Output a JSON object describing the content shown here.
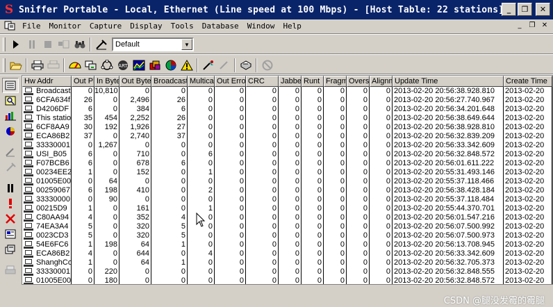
{
  "window": {
    "title": "Sniffer Portable - Local, Ethernet (Line speed at 100 Mbps) - [Host Table: 22 stations]",
    "logo": "S",
    "minimize": "_",
    "restore": "❐",
    "close": "✕"
  },
  "menu": [
    "File",
    "Monitor",
    "Capture",
    "Display",
    "Tools",
    "Database",
    "Window",
    "Help"
  ],
  "mdi": {
    "minimize": "_",
    "restore": "❐",
    "close": "✕"
  },
  "toolbar1": {
    "profile_value": "Default"
  },
  "columns": [
    "Hw Addr",
    "Out Pk",
    "In Byte",
    "Out Byte",
    "Broadcast",
    "Multicast",
    "Out Error",
    "CRC",
    "Jabber",
    "Runt",
    "Fragm",
    "Overs",
    "Alignm",
    "Update Time",
    "Create Time"
  ],
  "rows": [
    [
      "Broadcast",
      "0",
      "10,810",
      "0",
      "0",
      "0",
      "0",
      "0",
      "0",
      "0",
      "0",
      "0",
      "0",
      "2013-02-20 20:56:38.928.810",
      "2013-02-20"
    ],
    [
      "6CFA634f",
      "26",
      "0",
      "2,496",
      "26",
      "0",
      "0",
      "0",
      "0",
      "0",
      "0",
      "0",
      "0",
      "2013-02-20 20:56:27.740.967",
      "2013-02-20"
    ],
    [
      "D4206DF",
      "6",
      "0",
      "384",
      "6",
      "0",
      "0",
      "0",
      "0",
      "0",
      "0",
      "0",
      "0",
      "2013-02-20 20:56:34.201.648",
      "2013-02-20"
    ],
    [
      "This station",
      "35",
      "454",
      "2,252",
      "26",
      "0",
      "0",
      "0",
      "0",
      "0",
      "0",
      "0",
      "0",
      "2013-02-20 20:56:38.649.644",
      "2013-02-20"
    ],
    [
      "6CF8AA9",
      "30",
      "192",
      "1,926",
      "27",
      "0",
      "0",
      "0",
      "0",
      "0",
      "0",
      "0",
      "0",
      "2013-02-20 20:56:38.928.810",
      "2013-02-20"
    ],
    [
      "ECA86B2",
      "37",
      "0",
      "2,740",
      "37",
      "0",
      "0",
      "0",
      "0",
      "0",
      "0",
      "0",
      "0",
      "2013-02-20 20:56:32.839.209",
      "2013-02-20"
    ],
    [
      "33330001",
      "0",
      "1,267",
      "0",
      "0",
      "0",
      "0",
      "0",
      "0",
      "0",
      "0",
      "0",
      "0",
      "2013-02-20 20:56:33.342.609",
      "2013-02-20"
    ],
    [
      "USI_B05",
      "6",
      "0",
      "710",
      "0",
      "6",
      "0",
      "0",
      "0",
      "0",
      "0",
      "0",
      "0",
      "2013-02-20 20:56:32.848.572",
      "2013-02-20"
    ],
    [
      "F07BCB6",
      "6",
      "0",
      "678",
      "6",
      "0",
      "0",
      "0",
      "0",
      "0",
      "0",
      "0",
      "0",
      "2013-02-20 20:56:01.611.222",
      "2013-02-20"
    ],
    [
      "00234EE2",
      "1",
      "0",
      "152",
      "0",
      "1",
      "0",
      "0",
      "0",
      "0",
      "0",
      "0",
      "0",
      "2013-02-20 20:55:31.493.146",
      "2013-02-20"
    ],
    [
      "01005E00",
      "0",
      "64",
      "0",
      "0",
      "0",
      "0",
      "0",
      "0",
      "0",
      "0",
      "0",
      "0",
      "2013-02-20 20:55:37.118.466",
      "2013-02-20"
    ],
    [
      "00259067",
      "6",
      "198",
      "410",
      "0",
      "2",
      "0",
      "0",
      "0",
      "0",
      "0",
      "0",
      "0",
      "2013-02-20 20:56:38.428.184",
      "2013-02-20"
    ],
    [
      "33330000",
      "0",
      "90",
      "0",
      "0",
      "0",
      "0",
      "0",
      "0",
      "0",
      "0",
      "0",
      "0",
      "2013-02-20 20:55:37.118.484",
      "2013-02-20"
    ],
    [
      "00215D9",
      "1",
      "0",
      "161",
      "0",
      "1",
      "0",
      "0",
      "0",
      "0",
      "0",
      "0",
      "0",
      "2013-02-20 20:55:44.370.701",
      "2013-02-20"
    ],
    [
      "C80AA94",
      "4",
      "0",
      "352",
      "4",
      "0",
      "0",
      "0",
      "0",
      "0",
      "0",
      "0",
      "0",
      "2013-02-20 20:56:01.547.216",
      "2013-02-20"
    ],
    [
      "74EA3A4",
      "5",
      "0",
      "320",
      "5",
      "0",
      "0",
      "0",
      "0",
      "0",
      "0",
      "0",
      "0",
      "2013-02-20 20:56:07.500.992",
      "2013-02-20"
    ],
    [
      "0023CD3",
      "5",
      "0",
      "320",
      "5",
      "0",
      "0",
      "0",
      "0",
      "0",
      "0",
      "0",
      "0",
      "2013-02-20 20:56:07.500.973",
      "2013-02-20"
    ],
    [
      "54E6FC6",
      "1",
      "198",
      "64",
      "1",
      "0",
      "0",
      "0",
      "0",
      "0",
      "0",
      "0",
      "0",
      "2013-02-20 20:56:13.708.945",
      "2013-02-20"
    ],
    [
      "ECA86B2",
      "4",
      "0",
      "644",
      "0",
      "4",
      "0",
      "0",
      "0",
      "0",
      "0",
      "0",
      "0",
      "2013-02-20 20:56:33.342.609",
      "2013-02-20"
    ],
    [
      "ShanghCo",
      "1",
      "0",
      "64",
      "1",
      "0",
      "0",
      "0",
      "0",
      "0",
      "0",
      "0",
      "0",
      "2013-02-20 20:56:32.705.373",
      "2013-02-20"
    ],
    [
      "33330001",
      "0",
      "220",
      "0",
      "0",
      "0",
      "0",
      "0",
      "0",
      "0",
      "0",
      "0",
      "0",
      "2013-02-20 20:56:32.848.555",
      "2013-02-20"
    ],
    [
      "01005E00",
      "0",
      "180",
      "0",
      "0",
      "0",
      "0",
      "0",
      "0",
      "0",
      "0",
      "0",
      "0",
      "2013-02-20 20:56:32.848.572",
      "2013-02-20"
    ]
  ],
  "watermark": "CSDN @腿没发霉的霉腿"
}
